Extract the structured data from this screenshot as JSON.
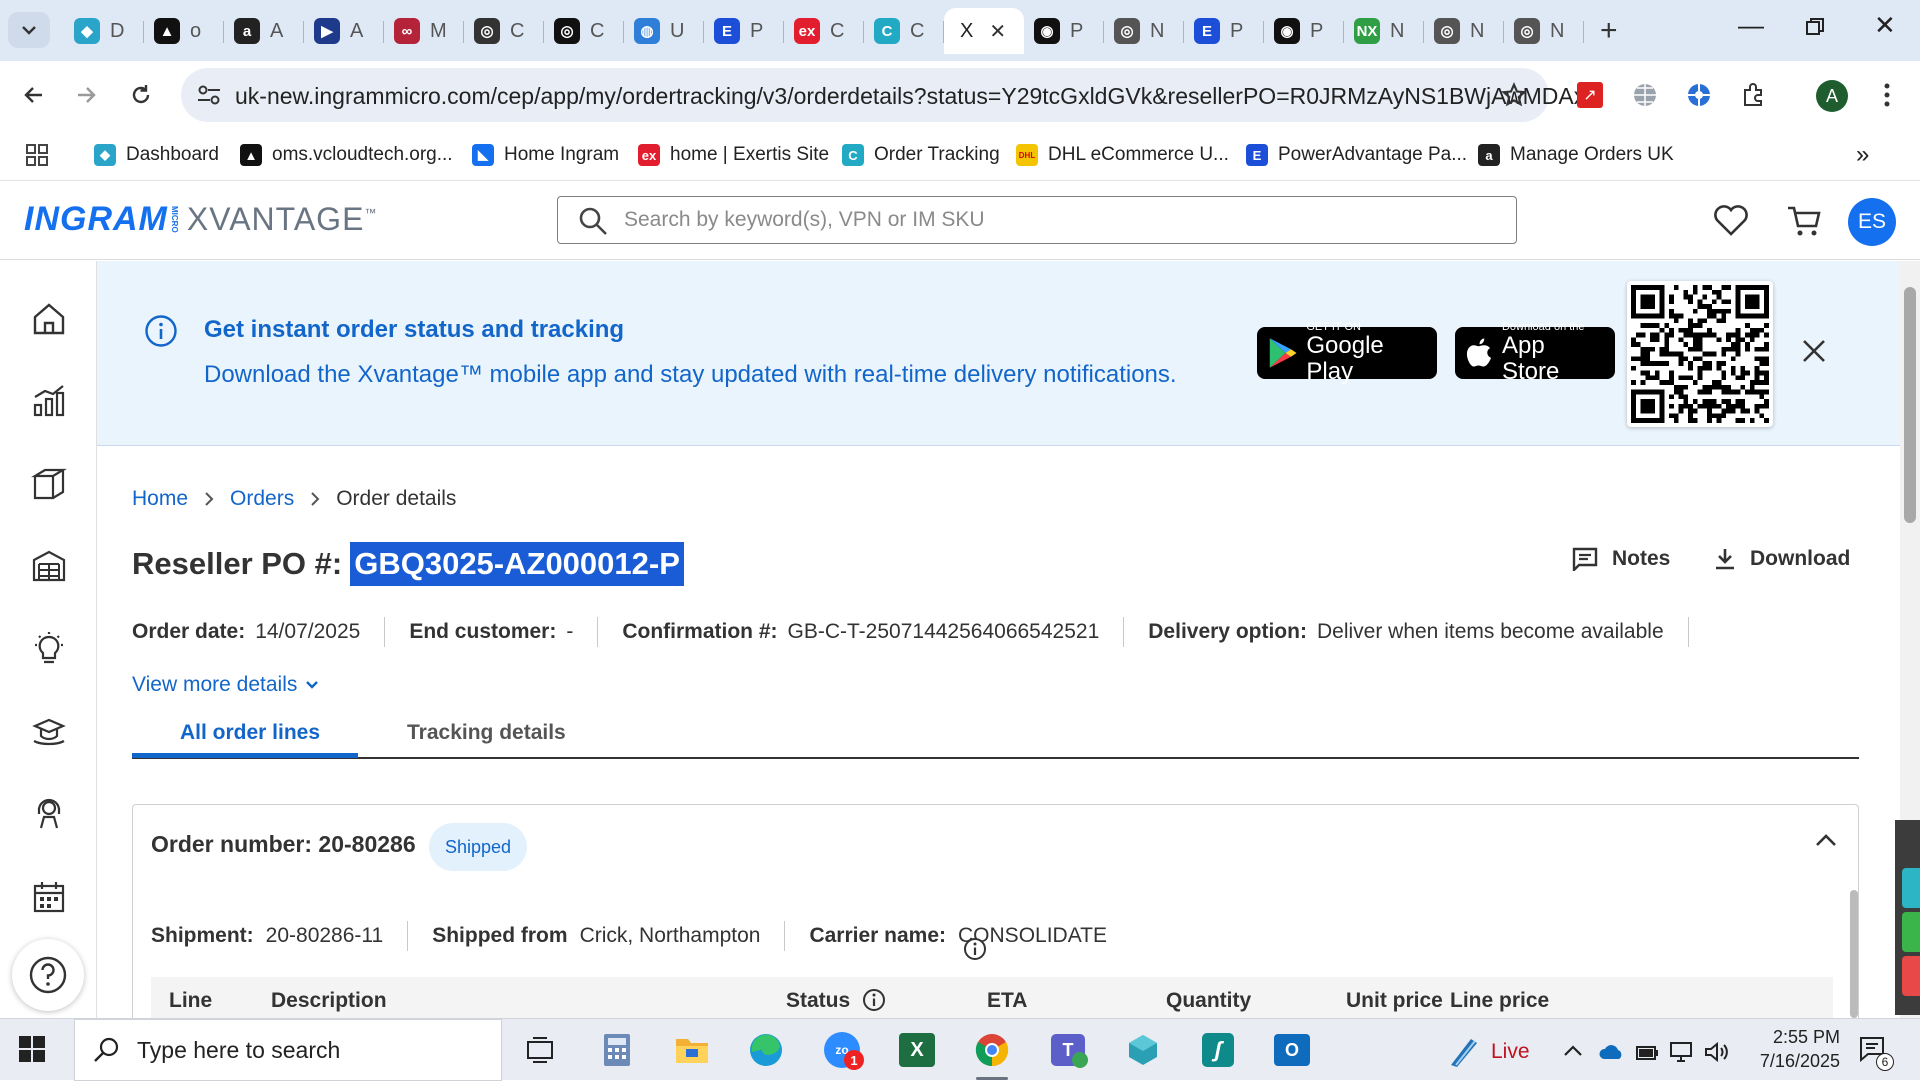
{
  "browser": {
    "tabs": [
      {
        "letter": "D",
        "color": "#2aa5c9",
        "glyph": "◆"
      },
      {
        "letter": "o",
        "color": "#111111",
        "glyph": "▲"
      },
      {
        "letter": "A",
        "color": "#222222",
        "glyph": "a"
      },
      {
        "letter": "A",
        "color": "#1f3a8a",
        "glyph": "▶"
      },
      {
        "letter": "M",
        "color": "#b4233a",
        "glyph": "∞"
      },
      {
        "letter": "C",
        "color": "#333333",
        "glyph": "◎"
      },
      {
        "letter": "C",
        "color": "#111111",
        "glyph": "◎"
      },
      {
        "letter": "U",
        "color": "#2f7fd8",
        "glyph": "◍"
      },
      {
        "letter": "P",
        "color": "#1d4ed8",
        "glyph": "E"
      },
      {
        "letter": "C",
        "color": "#e11d2e",
        "glyph": "ex"
      },
      {
        "letter": "C",
        "color": "#22a9c4",
        "glyph": "C"
      },
      {
        "letter": "X",
        "color": "#ffffff",
        "glyph": "",
        "active": true
      },
      {
        "letter": "P",
        "color": "#111111",
        "glyph": "◉"
      },
      {
        "letter": "N",
        "color": "#555555",
        "glyph": "◎"
      },
      {
        "letter": "P",
        "color": "#1d4ed8",
        "glyph": "E"
      },
      {
        "letter": "P",
        "color": "#111111",
        "glyph": "◉"
      },
      {
        "letter": "N",
        "color": "#2f9e44",
        "glyph": "NX"
      },
      {
        "letter": "N",
        "color": "#555555",
        "glyph": "◎"
      },
      {
        "letter": "N",
        "color": "#555555",
        "glyph": "◎"
      }
    ],
    "url": "uk-new.ingrammicro.com/cep/app/my/ordertracking/v3/orderdetails?status=Y29tcGxldGVk&resellerPO=R0JRMzAyNS1BWjAwMDAx...",
    "profile_initial": "A",
    "bookmarks": [
      {
        "label": "Dashboard",
        "color": "#2aa5c9",
        "glyph": "◆"
      },
      {
        "label": "oms.vcloudtech.org...",
        "color": "#111111",
        "glyph": "▲"
      },
      {
        "label": "Home Ingram",
        "color": "#1570ef",
        "glyph": "◣"
      },
      {
        "label": "home | Exertis Site",
        "color": "#e11d2e",
        "glyph": "ex"
      },
      {
        "label": "Order Tracking",
        "color": "#22a9c4",
        "glyph": "C"
      },
      {
        "label": "DHL eCommerce U...",
        "color": "#f5c400",
        "glyph": "DHL"
      },
      {
        "label": "PowerAdvantage Pa...",
        "color": "#1d4ed8",
        "glyph": "E"
      },
      {
        "label": "Manage Orders UK",
        "color": "#222222",
        "glyph": "a"
      }
    ]
  },
  "site": {
    "logo_main": "INGRAM",
    "logo_micro": "MICRO",
    "logo_secondary": "XVANTAGE",
    "logo_tm": "™",
    "search_placeholder": "Search by keyword(s), VPN or IM SKU",
    "user_initials": "ES"
  },
  "banner": {
    "title": "Get instant order status and tracking",
    "subtitle": "Download the Xvantage™ mobile app and stay updated with real-time delivery notifications.",
    "google_small": "GET IT ON",
    "google_big": "Google Play",
    "apple_small": "Download on the",
    "apple_big": "App Store"
  },
  "breadcrumb": {
    "home": "Home",
    "orders": "Orders",
    "current": "Order details"
  },
  "order": {
    "po_label": "Reseller PO #:",
    "po_value": "GBQ3025-AZ000012-P",
    "notes_label": "Notes",
    "download_label": "Download",
    "meta": {
      "order_date_label": "Order date:",
      "order_date": "14/07/2025",
      "end_customer_label": "End customer:",
      "end_customer": "-",
      "confirmation_label": "Confirmation #:",
      "confirmation": "GB-C-T-25071442564066542521",
      "delivery_label": "Delivery option:",
      "delivery": "Deliver when items become available"
    },
    "view_more": "View more details",
    "tabs": {
      "all_lines": "All order lines",
      "tracking": "Tracking details"
    },
    "card": {
      "order_number": "Order number: 20-80286",
      "status": "Shipped",
      "shipment_label": "Shipment:",
      "shipment": "20-80286-11",
      "shipped_from_label": "Shipped from",
      "shipped_from": "Crick, Northampton",
      "carrier_label": "Carrier name:",
      "carrier": "CONSOLIDATE",
      "columns": [
        "Line",
        "Description",
        "Status",
        "ETA",
        "Quantity",
        "Unit price",
        "Line price"
      ]
    }
  },
  "taskbar": {
    "search_placeholder": "Type here to search",
    "live": "Live",
    "time": "2:55 PM",
    "date": "7/16/2025",
    "notification_count": "6",
    "teams_badge": "1"
  }
}
